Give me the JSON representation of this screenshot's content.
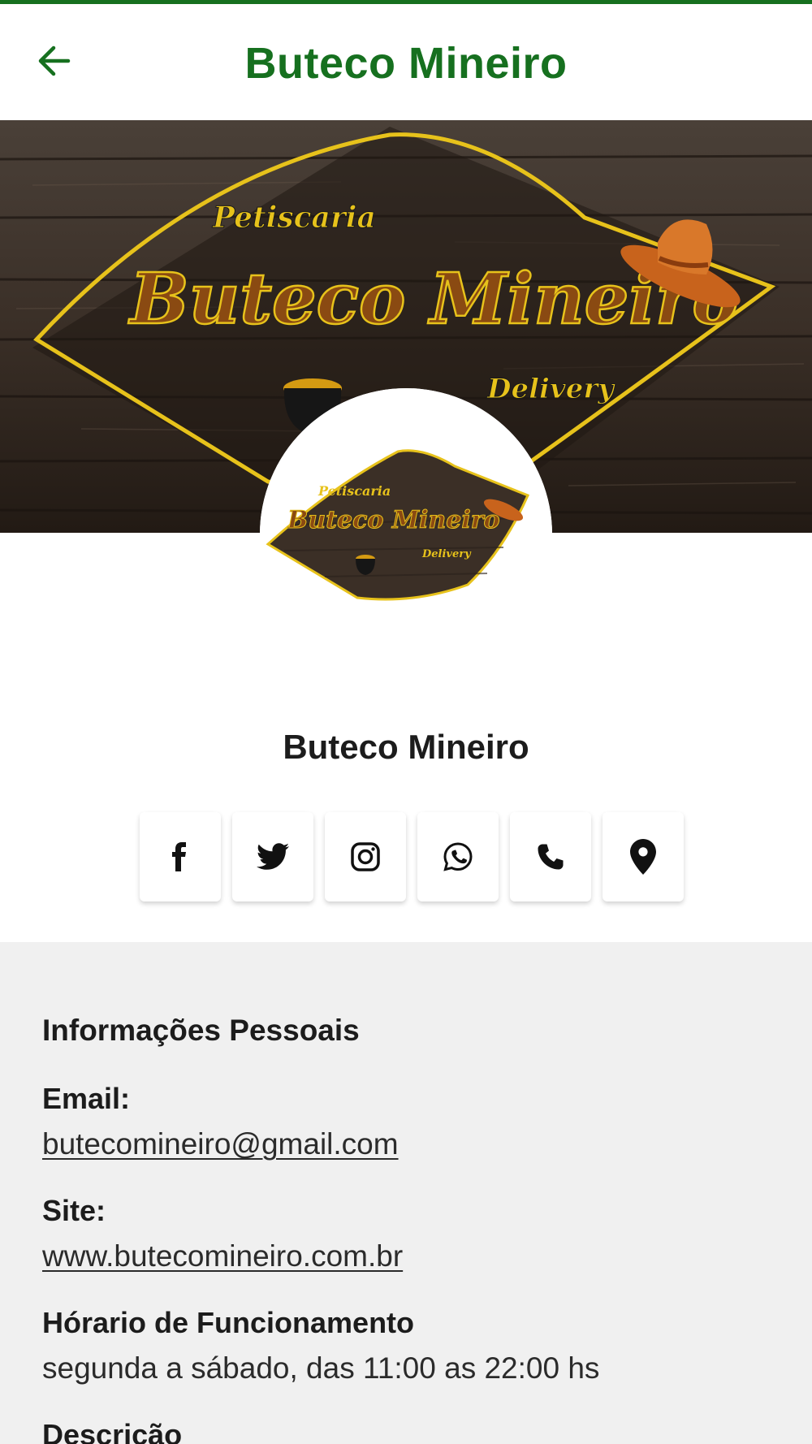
{
  "app_bar": {
    "title": "Buteco Mineiro",
    "back_icon": "arrow-left-icon",
    "accent_color": "#16701f"
  },
  "cover": {
    "logo_tagline": "Petiscaria",
    "logo_name": "Buteco Mineiro",
    "logo_subtitle": "Delivery"
  },
  "profile": {
    "name": "Buteco Mineiro"
  },
  "social_buttons": [
    {
      "name": "facebook",
      "icon": "facebook-icon"
    },
    {
      "name": "twitter",
      "icon": "twitter-icon"
    },
    {
      "name": "instagram",
      "icon": "instagram-icon"
    },
    {
      "name": "whatsapp",
      "icon": "whatsapp-icon"
    },
    {
      "name": "phone",
      "icon": "phone-icon"
    },
    {
      "name": "location",
      "icon": "map-pin-icon"
    }
  ],
  "info": {
    "heading": "Informações Pessoais",
    "email_label": "Email:",
    "email_value": "butecomineiro@gmail.com",
    "site_label": "Site:",
    "site_value": "www.butecomineiro.com.br",
    "hours_label": "Hórario de Funcionamento",
    "hours_value": "segunda a sábado, das 11:00 as 22:00 hs",
    "description_label": "Descrição"
  }
}
